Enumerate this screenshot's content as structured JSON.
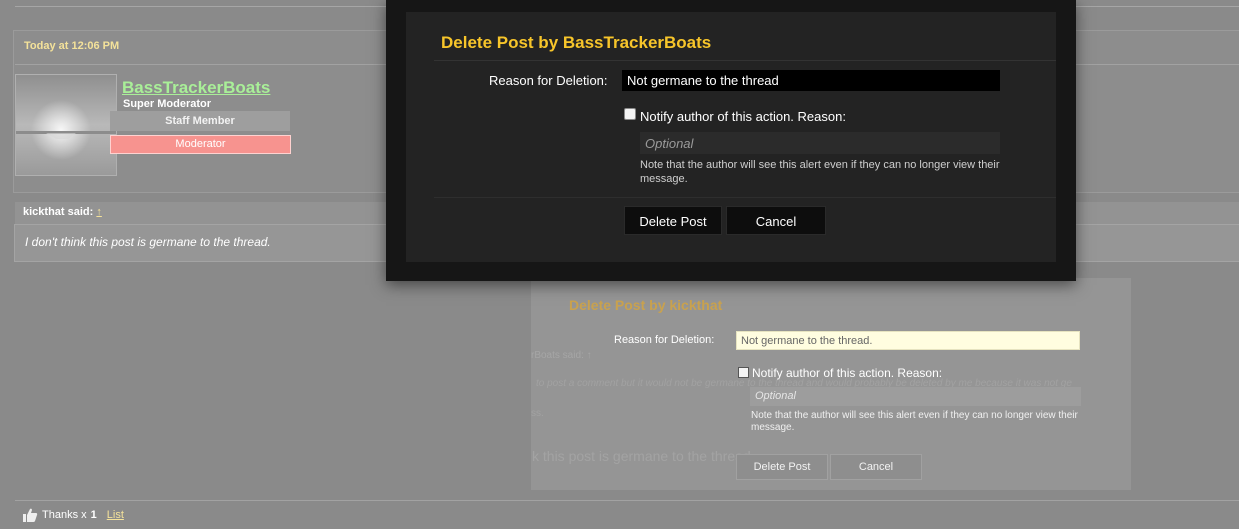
{
  "post": {
    "date": "Today at 12:06 PM",
    "username": "BassTrackerBoats",
    "user_title": "Super Moderator",
    "banner_staff": "Staff Member",
    "banner_moderator": "Moderator",
    "quote_author": "kickthat said:",
    "quote_arrow": "↑",
    "quote_text": "I don't think this post is germane to the thread.",
    "thanks_label": "Thanks x",
    "thanks_count": "1",
    "thanks_list": "List"
  },
  "ghost_dialog": {
    "title": "Delete Post by kickthat",
    "reason_label": "Reason for Deletion:",
    "reason_value": "Not germane to the thread.",
    "notify_label": "Notify author of this action. Reason:",
    "optional_placeholder": "Optional",
    "note": "Note that the author will see this alert even if they can no longer view their message.",
    "delete_label": "Delete Post",
    "cancel_label": "Cancel",
    "faint_quote_author": "rBoats said: ↑",
    "faint_quote_text": "to post a comment but it would not be germane to the thread and would probably be deleted by me because it was not ge",
    "faint_misc": "ss.",
    "faint_bottom_text": "k this post is germane to the thread."
  },
  "dialog": {
    "title": "Delete Post by BassTrackerBoats",
    "reason_label": "Reason for Deletion:",
    "reason_value": "Not germane to the thread",
    "notify_checked": false,
    "notify_label": "Notify author of this action. Reason:",
    "optional_placeholder": "Optional",
    "note": "Note that the author will see this alert even if they can no longer view their message.",
    "delete_label": "Delete Post",
    "cancel_label": "Cancel"
  },
  "colors": {
    "dialog_title": "#f7c52a",
    "username": "#a9ef98",
    "moderator_banner": "#f7938f",
    "date_text": "#f4e29a"
  }
}
